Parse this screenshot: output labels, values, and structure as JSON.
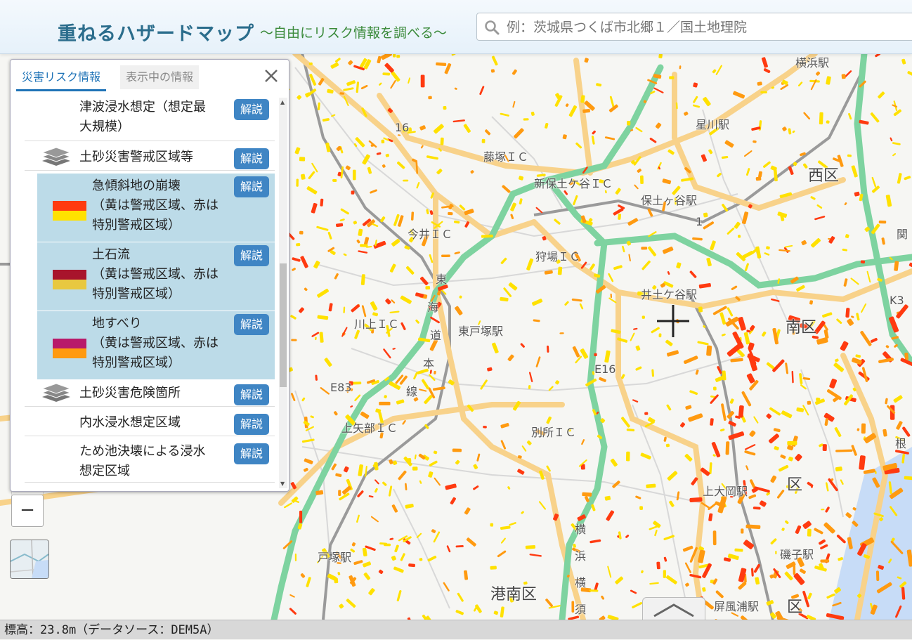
{
  "header": {
    "title": "重ねるハザードマップ",
    "subtitle": "～自由にリスク情報を調べる～",
    "search_placeholder": "例：茨城県つくば市北郷１／国土地理院"
  },
  "panel": {
    "tabs": [
      {
        "label": "災害リスク情報",
        "active": true
      },
      {
        "label": "表示中の情報",
        "active": false
      }
    ],
    "explain_label": "解説",
    "items": [
      {
        "lines": [
          "津波浸水想定（想定最",
          "大規模）"
        ],
        "type": "item"
      },
      {
        "lines": [
          "土砂災害警戒区域等"
        ],
        "type": "group",
        "icon": "layers-icon"
      },
      {
        "lines": [
          "急傾斜地の崩壊",
          "（黄は警戒区域、赤は",
          "特別警戒区域）"
        ],
        "type": "sub",
        "swatch": [
          "#ff3a10",
          "#ffe100"
        ]
      },
      {
        "lines": [
          "土石流",
          "（黄は警戒区域、赤は",
          "特別警戒区域）"
        ],
        "type": "sub",
        "swatch": [
          "#a8142c",
          "#e8c840"
        ]
      },
      {
        "lines": [
          "地すべり",
          "（黄は警戒区域、赤は",
          "特別警戒区域）"
        ],
        "type": "sub",
        "swatch": [
          "#b81a6a",
          "#ff9a10"
        ]
      },
      {
        "lines": [
          "土砂災害危険箇所"
        ],
        "type": "group",
        "icon": "layers-icon"
      },
      {
        "lines": [
          "内水浸水想定区域"
        ],
        "type": "item"
      },
      {
        "lines": [
          "ため池決壊による浸水",
          "想定区域"
        ],
        "type": "item"
      }
    ]
  },
  "map": {
    "labels": [
      {
        "text": "横浜駅",
        "size": "small"
      },
      {
        "text": "星川駅",
        "size": "small"
      },
      {
        "text": "西区",
        "size": "big"
      },
      {
        "text": "藤塚ＩＣ",
        "size": "small"
      },
      {
        "text": "新保土ケ谷ＩＣ",
        "size": "small"
      },
      {
        "text": "保土ヶ谷駅",
        "size": "small"
      },
      {
        "text": "今井ＩＣ",
        "size": "small"
      },
      {
        "text": "狩場ＩＣ",
        "size": "small"
      },
      {
        "text": "井土ケ谷駅",
        "size": "small"
      },
      {
        "text": "川上ＩＣ",
        "size": "small"
      },
      {
        "text": "東戸塚駅",
        "size": "small"
      },
      {
        "text": "南区",
        "size": "big"
      },
      {
        "text": "上矢部ＩＣ",
        "size": "small"
      },
      {
        "text": "別所ＩＣ",
        "size": "small"
      },
      {
        "text": "上大岡駅",
        "size": "small"
      },
      {
        "text": "戸塚駅",
        "size": "small"
      },
      {
        "text": "港南区",
        "size": "big"
      },
      {
        "text": "磯子駅",
        "size": "small"
      },
      {
        "text": "屏風浦駅",
        "size": "small"
      },
      {
        "text": "関",
        "size": "small"
      },
      {
        "text": "根",
        "size": "small"
      },
      {
        "text": "区",
        "size": "big"
      },
      {
        "text": "区",
        "size": "big"
      },
      {
        "text": "横",
        "size": "small"
      },
      {
        "text": "浜",
        "size": "small"
      },
      {
        "text": "横",
        "size": "small"
      },
      {
        "text": "須",
        "size": "small"
      },
      {
        "text": "東",
        "size": "small"
      },
      {
        "text": "海",
        "size": "small"
      },
      {
        "text": "道",
        "size": "small"
      },
      {
        "text": "本",
        "size": "small"
      },
      {
        "text": "線",
        "size": "small"
      },
      {
        "text": "E83",
        "size": "small"
      },
      {
        "text": "E16",
        "size": "small"
      },
      {
        "text": "16",
        "size": "small"
      },
      {
        "text": "K3",
        "size": "small"
      },
      {
        "text": "1",
        "size": "small"
      }
    ],
    "colors": {
      "highway": "#7ed3a0",
      "road": "#f8d28a",
      "rail": "#999999",
      "hazard_yellow": "#ffe100",
      "hazard_orange": "#ff9a10",
      "hazard_red": "#ff3a10",
      "water": "#c7dcf7"
    }
  },
  "zoom": {
    "in": "+",
    "out": "−"
  },
  "status": {
    "text": "標高：23.8m（データソース：DEM5A）"
  }
}
